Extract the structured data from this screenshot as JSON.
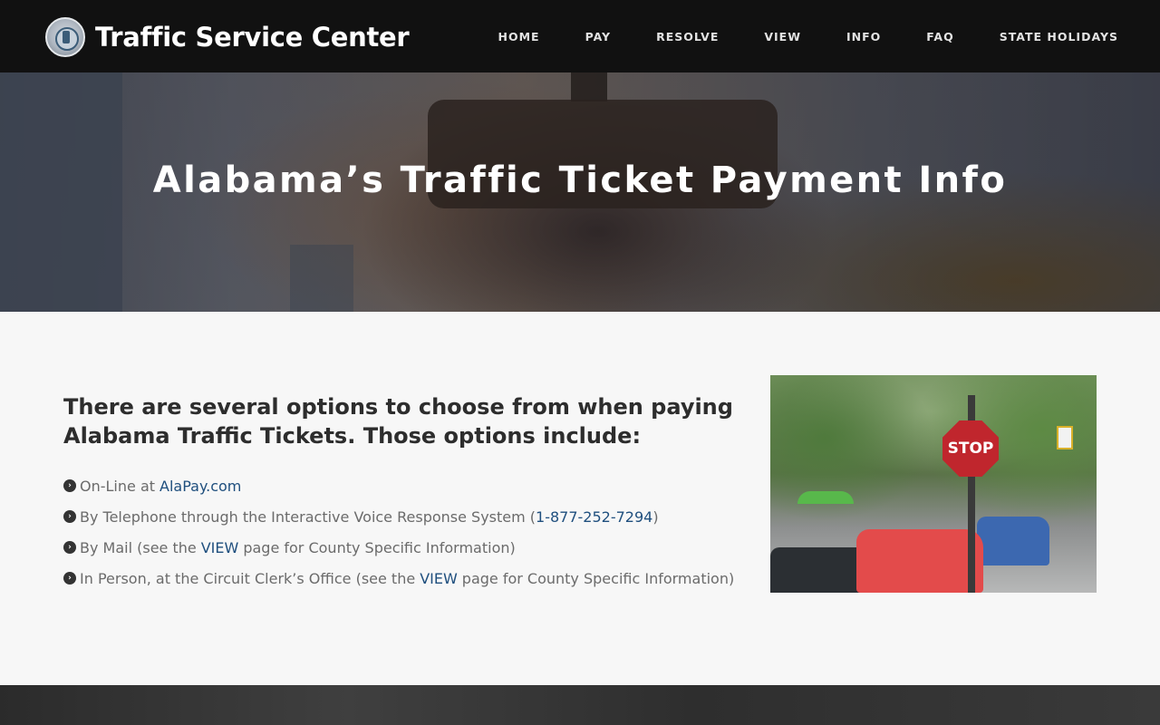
{
  "site": {
    "title": "Traffic Service Center",
    "logo_icon": "state-seal-icon"
  },
  "nav": {
    "items": [
      {
        "label": "HOME"
      },
      {
        "label": "PAY"
      },
      {
        "label": "RESOLVE"
      },
      {
        "label": "VIEW"
      },
      {
        "label": "INFO"
      },
      {
        "label": "FAQ"
      },
      {
        "label": "STATE HOLIDAYS"
      }
    ]
  },
  "hero": {
    "title": "Alabama’s Traffic Ticket Payment Info"
  },
  "main": {
    "intro": "There are several options to choose from when paying Alabama Traffic Tickets. Those options include:",
    "options": [
      {
        "prefix": "On-Line at ",
        "link": "AlaPay.com",
        "suffix": ""
      },
      {
        "prefix": "By Telephone through the Interactive Voice Response System (",
        "link": "1-877-252-7294",
        "suffix": ")"
      },
      {
        "prefix": "By Mail (see the ",
        "link": "VIEW",
        "suffix": " page for County Specific Information)"
      },
      {
        "prefix": "In Person, at the Circuit Clerk’s Office (see the ",
        "link": "VIEW",
        "suffix": " page for County Specific Information)"
      }
    ],
    "bullet_icon": "chevron-circle-right-icon",
    "photo_sign_text": "STOP"
  },
  "colors": {
    "header_bg": "#111111",
    "link": "#1f4f7e",
    "body_text": "#6b6b6b",
    "page_bg": "#f7f7f7"
  }
}
